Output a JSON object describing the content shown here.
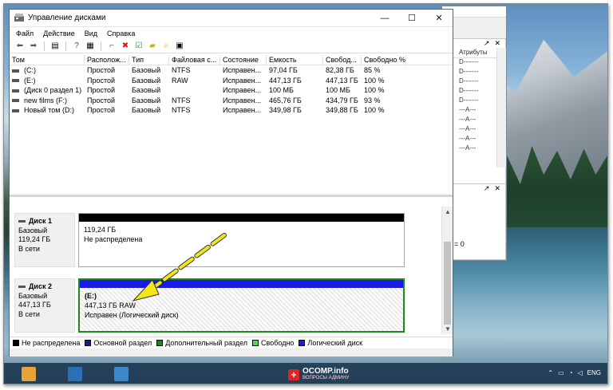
{
  "window": {
    "title": "Управление дисками",
    "controls": {
      "minimize": "—",
      "maximize": "☐",
      "close": "✕"
    }
  },
  "menu": [
    "Файл",
    "Действие",
    "Вид",
    "Справка"
  ],
  "toolbar_icons": [
    "back-icon",
    "forward-icon",
    "list-icon",
    "help-icon",
    "properties-icon",
    "connect-icon",
    "delete-icon",
    "check-icon",
    "new-folder-icon",
    "search-icon",
    "info-icon"
  ],
  "volume_table": {
    "headers": [
      "Том",
      "Располож...",
      "Тип",
      "Файловая с...",
      "Состояние",
      "Емкость",
      "Свобод...",
      "Свободно %"
    ],
    "rows": [
      [
        "(C:)",
        "Простой",
        "Базовый",
        "NTFS",
        "Исправен...",
        "97,04 ГБ",
        "82,38 ГБ",
        "85 %"
      ],
      [
        "(E:)",
        "Простой",
        "Базовый",
        "RAW",
        "Исправен...",
        "447,13 ГБ",
        "447,13 ГБ",
        "100 %"
      ],
      [
        "(Диск 0 раздел 1)",
        "Простой",
        "Базовый",
        "",
        "Исправен...",
        "100 МБ",
        "100 МБ",
        "100 %"
      ],
      [
        "new films (F:)",
        "Простой",
        "Базовый",
        "NTFS",
        "Исправен...",
        "465,76 ГБ",
        "434,79 ГБ",
        "93 %"
      ],
      [
        "Новый том (D:)",
        "Простой",
        "Базовый",
        "NTFS",
        "Исправен...",
        "349,98 ГБ",
        "349,88 ГБ",
        "100 %"
      ]
    ]
  },
  "disks": [
    {
      "name": "Диск 1",
      "type": "Базовый",
      "size": "119,24 ГБ",
      "status": "В сети",
      "partition": {
        "line1": "",
        "line2": "119,24 ГБ",
        "line3": "Не распределена"
      }
    },
    {
      "name": "Диск 2",
      "type": "Базовый",
      "size": "447,13 ГБ",
      "status": "В сети",
      "partition": {
        "line1": "(E:)",
        "line2": "447,13 ГБ RAW",
        "line3": "Исправен (Логический диск)"
      }
    }
  ],
  "legend": [
    {
      "label": "Не распределена",
      "color": "#000000"
    },
    {
      "label": "Основной раздел",
      "color": "#1a1a8c"
    },
    {
      "label": "Дополнительный раздел",
      "color": "#1a8c1a"
    },
    {
      "label": "Свободно",
      "color": "#4cd94c"
    },
    {
      "label": "Логический диск",
      "color": "#1a1ae6"
    }
  ],
  "background_window": {
    "column_header": "Атрибуты",
    "attributes": [
      "D-------",
      "D-------",
      "D-------",
      "D-------",
      "D-------",
      "---A---",
      "---A---",
      "---A---",
      "---A---",
      "---A---"
    ],
    "footer_value": "= 0"
  },
  "taskbar": {
    "brand_title": "OCOMP.info",
    "brand_subtitle": "ВОПРОСЫ АДМИНУ",
    "language": "ENG"
  },
  "colors": {
    "accent_border": "#1a74c2",
    "annotation_arrow": "#f2e619"
  }
}
